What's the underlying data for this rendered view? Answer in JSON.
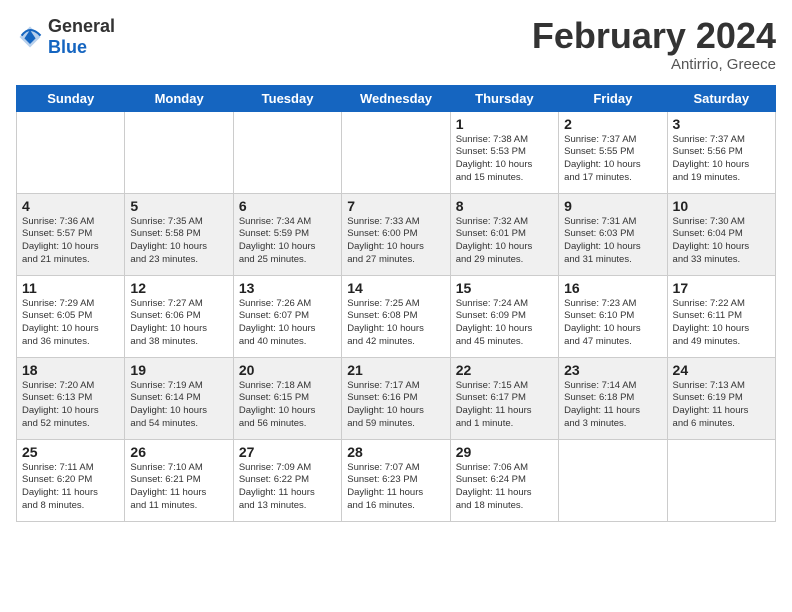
{
  "logo": {
    "text_general": "General",
    "text_blue": "Blue"
  },
  "header": {
    "month": "February 2024",
    "location": "Antirrio, Greece"
  },
  "days": [
    "Sunday",
    "Monday",
    "Tuesday",
    "Wednesday",
    "Thursday",
    "Friday",
    "Saturday"
  ],
  "weeks": [
    [
      {
        "date": "",
        "info": ""
      },
      {
        "date": "",
        "info": ""
      },
      {
        "date": "",
        "info": ""
      },
      {
        "date": "",
        "info": ""
      },
      {
        "date": "1",
        "info": "Sunrise: 7:38 AM\nSunset: 5:53 PM\nDaylight: 10 hours\nand 15 minutes."
      },
      {
        "date": "2",
        "info": "Sunrise: 7:37 AM\nSunset: 5:55 PM\nDaylight: 10 hours\nand 17 minutes."
      },
      {
        "date": "3",
        "info": "Sunrise: 7:37 AM\nSunset: 5:56 PM\nDaylight: 10 hours\nand 19 minutes."
      }
    ],
    [
      {
        "date": "4",
        "info": "Sunrise: 7:36 AM\nSunset: 5:57 PM\nDaylight: 10 hours\nand 21 minutes."
      },
      {
        "date": "5",
        "info": "Sunrise: 7:35 AM\nSunset: 5:58 PM\nDaylight: 10 hours\nand 23 minutes."
      },
      {
        "date": "6",
        "info": "Sunrise: 7:34 AM\nSunset: 5:59 PM\nDaylight: 10 hours\nand 25 minutes."
      },
      {
        "date": "7",
        "info": "Sunrise: 7:33 AM\nSunset: 6:00 PM\nDaylight: 10 hours\nand 27 minutes."
      },
      {
        "date": "8",
        "info": "Sunrise: 7:32 AM\nSunset: 6:01 PM\nDaylight: 10 hours\nand 29 minutes."
      },
      {
        "date": "9",
        "info": "Sunrise: 7:31 AM\nSunset: 6:03 PM\nDaylight: 10 hours\nand 31 minutes."
      },
      {
        "date": "10",
        "info": "Sunrise: 7:30 AM\nSunset: 6:04 PM\nDaylight: 10 hours\nand 33 minutes."
      }
    ],
    [
      {
        "date": "11",
        "info": "Sunrise: 7:29 AM\nSunset: 6:05 PM\nDaylight: 10 hours\nand 36 minutes."
      },
      {
        "date": "12",
        "info": "Sunrise: 7:27 AM\nSunset: 6:06 PM\nDaylight: 10 hours\nand 38 minutes."
      },
      {
        "date": "13",
        "info": "Sunrise: 7:26 AM\nSunset: 6:07 PM\nDaylight: 10 hours\nand 40 minutes."
      },
      {
        "date": "14",
        "info": "Sunrise: 7:25 AM\nSunset: 6:08 PM\nDaylight: 10 hours\nand 42 minutes."
      },
      {
        "date": "15",
        "info": "Sunrise: 7:24 AM\nSunset: 6:09 PM\nDaylight: 10 hours\nand 45 minutes."
      },
      {
        "date": "16",
        "info": "Sunrise: 7:23 AM\nSunset: 6:10 PM\nDaylight: 10 hours\nand 47 minutes."
      },
      {
        "date": "17",
        "info": "Sunrise: 7:22 AM\nSunset: 6:11 PM\nDaylight: 10 hours\nand 49 minutes."
      }
    ],
    [
      {
        "date": "18",
        "info": "Sunrise: 7:20 AM\nSunset: 6:13 PM\nDaylight: 10 hours\nand 52 minutes."
      },
      {
        "date": "19",
        "info": "Sunrise: 7:19 AM\nSunset: 6:14 PM\nDaylight: 10 hours\nand 54 minutes."
      },
      {
        "date": "20",
        "info": "Sunrise: 7:18 AM\nSunset: 6:15 PM\nDaylight: 10 hours\nand 56 minutes."
      },
      {
        "date": "21",
        "info": "Sunrise: 7:17 AM\nSunset: 6:16 PM\nDaylight: 10 hours\nand 59 minutes."
      },
      {
        "date": "22",
        "info": "Sunrise: 7:15 AM\nSunset: 6:17 PM\nDaylight: 11 hours\nand 1 minute."
      },
      {
        "date": "23",
        "info": "Sunrise: 7:14 AM\nSunset: 6:18 PM\nDaylight: 11 hours\nand 3 minutes."
      },
      {
        "date": "24",
        "info": "Sunrise: 7:13 AM\nSunset: 6:19 PM\nDaylight: 11 hours\nand 6 minutes."
      }
    ],
    [
      {
        "date": "25",
        "info": "Sunrise: 7:11 AM\nSunset: 6:20 PM\nDaylight: 11 hours\nand 8 minutes."
      },
      {
        "date": "26",
        "info": "Sunrise: 7:10 AM\nSunset: 6:21 PM\nDaylight: 11 hours\nand 11 minutes."
      },
      {
        "date": "27",
        "info": "Sunrise: 7:09 AM\nSunset: 6:22 PM\nDaylight: 11 hours\nand 13 minutes."
      },
      {
        "date": "28",
        "info": "Sunrise: 7:07 AM\nSunset: 6:23 PM\nDaylight: 11 hours\nand 16 minutes."
      },
      {
        "date": "29",
        "info": "Sunrise: 7:06 AM\nSunset: 6:24 PM\nDaylight: 11 hours\nand 18 minutes."
      },
      {
        "date": "",
        "info": ""
      },
      {
        "date": "",
        "info": ""
      }
    ]
  ]
}
